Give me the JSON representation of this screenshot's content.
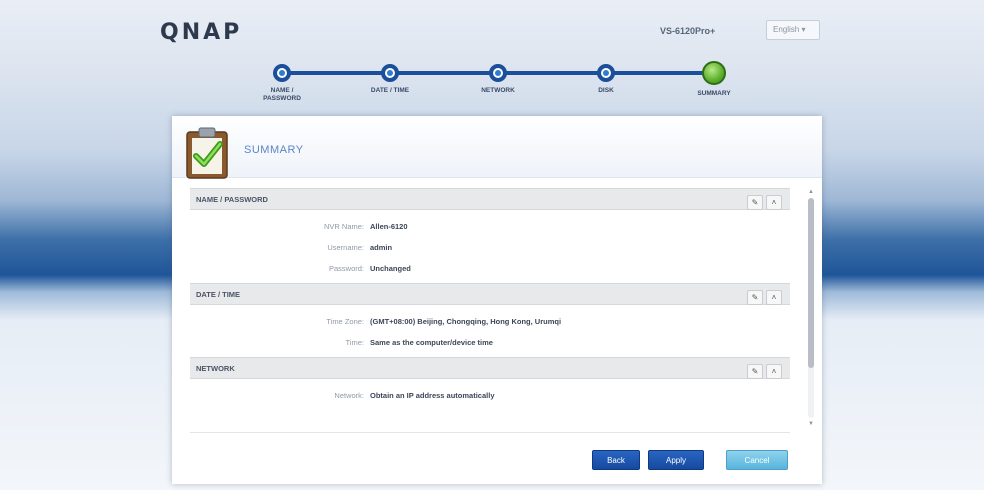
{
  "header": {
    "logo": "QNAP",
    "model": "VS-6120Pro+",
    "language": "English"
  },
  "wizard_steps": [
    {
      "label": "NAME / PASSWORD",
      "state": "done"
    },
    {
      "label": "DATE / TIME",
      "state": "done"
    },
    {
      "label": "NETWORK",
      "state": "done"
    },
    {
      "label": "DISK",
      "state": "done"
    },
    {
      "label": "SUMMARY",
      "state": "current"
    }
  ],
  "panel": {
    "title": "SUMMARY",
    "icon": "clipboard-check-icon"
  },
  "sections": [
    {
      "title": "NAME / PASSWORD",
      "rows": [
        {
          "label": "NVR Name:",
          "value": "Allen-6120"
        },
        {
          "label": "Username:",
          "value": "admin"
        },
        {
          "label": "Password:",
          "value": "Unchanged"
        }
      ]
    },
    {
      "title": "DATE / TIME",
      "rows": [
        {
          "label": "Time Zone:",
          "value": "(GMT+08:00) Beijing, Chongqing, Hong Kong, Urumqi"
        },
        {
          "label": "Time:",
          "value": "Same as the computer/device time"
        }
      ]
    },
    {
      "title": "NETWORK",
      "rows": [
        {
          "label": "Network:",
          "value": "Obtain an IP address automatically"
        }
      ]
    }
  ],
  "section_buttons": {
    "edit_icon": "pencil-icon",
    "collapse_icon": "chevron-up-icon"
  },
  "buttons": {
    "back": "Back",
    "apply": "Apply",
    "cancel": "Cancel"
  },
  "colors": {
    "accent_blue": "#1c4f9b",
    "current_step_green": "#5cae2c",
    "cancel_cyan": "#58b4dd",
    "title_blue": "#5d84c6"
  }
}
